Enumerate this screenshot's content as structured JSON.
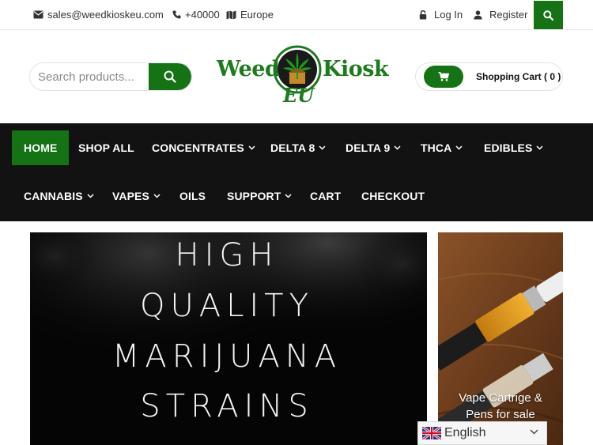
{
  "topbar": {
    "email": "sales@weedkioskeu.com",
    "phone": "+40000",
    "location": "Europe",
    "login": "Log In",
    "register": "Register",
    "icons": [
      "envelope-icon",
      "phone-icon",
      "map-icon",
      "lock-icon",
      "user-icon",
      "search-icon"
    ]
  },
  "header": {
    "search_placeholder": "Search products...",
    "logo": {
      "word1": "Weed",
      "word2": "Kiosk",
      "sub": "EU"
    },
    "cart_label": "Shopping Cart ( 0 )"
  },
  "nav": {
    "items": [
      {
        "label": "HOME",
        "active": true,
        "dropdown": false
      },
      {
        "label": "SHOP ALL",
        "active": false,
        "dropdown": false
      },
      {
        "label": "CONCENTRATES",
        "active": false,
        "dropdown": true
      },
      {
        "label": "DELTA 8",
        "active": false,
        "dropdown": true
      },
      {
        "label": "DELTA 9",
        "active": false,
        "dropdown": true
      },
      {
        "label": "THCA",
        "active": false,
        "dropdown": true
      },
      {
        "label": "EDIBLES",
        "active": false,
        "dropdown": true
      },
      {
        "label": "CANNABIS",
        "active": false,
        "dropdown": true
      },
      {
        "label": "VAPES",
        "active": false,
        "dropdown": true
      },
      {
        "label": "OILS",
        "active": false,
        "dropdown": false
      },
      {
        "label": "SUPPORT",
        "active": false,
        "dropdown": true
      },
      {
        "label": "CART",
        "active": false,
        "dropdown": false
      },
      {
        "label": "CHECKOUT",
        "active": false,
        "dropdown": false
      }
    ]
  },
  "hero": {
    "lines": [
      "HIGH",
      "QUALITY",
      "MARIJUANA",
      "STRAINS"
    ]
  },
  "side_banner": {
    "caption_line1": "Vape Cartrige &",
    "caption_line2": "Pens for sale"
  },
  "language": {
    "label": "English"
  },
  "colors": {
    "brand_green": "#157215",
    "nav_bg": "#121212",
    "logo_green": "#1e7a1e"
  }
}
